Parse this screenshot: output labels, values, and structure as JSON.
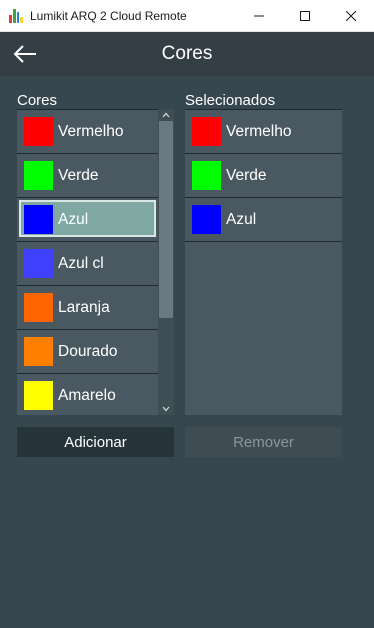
{
  "window": {
    "title": "Lumikit ARQ 2 Cloud Remote",
    "icons": [
      "app-logo-icon",
      "minimize-icon",
      "maximize-icon",
      "close-icon"
    ]
  },
  "appbar": {
    "title": "Cores",
    "back_icon": "arrow-left-icon"
  },
  "available": {
    "label": "Cores",
    "items": [
      {
        "name": "Vermelho",
        "color": "#ff0000"
      },
      {
        "name": "Verde",
        "color": "#00ff00"
      },
      {
        "name": "Azul",
        "color": "#0000ff",
        "selected": true
      },
      {
        "name": "Azul cl",
        "color": "#4040ff"
      },
      {
        "name": "Laranja",
        "color": "#ff6600"
      },
      {
        "name": "Dourado",
        "color": "#ff8000"
      },
      {
        "name": "Amarelo",
        "color": "#ffff00"
      }
    ],
    "scrollbar": {
      "up_icon": "chevron-up-icon",
      "down_icon": "chevron-down-icon"
    }
  },
  "selected": {
    "label": "Selecionados",
    "items": [
      {
        "name": "Vermelho",
        "color": "#ff0000"
      },
      {
        "name": "Verde",
        "color": "#00ff00"
      },
      {
        "name": "Azul",
        "color": "#0000ff"
      }
    ]
  },
  "actions": {
    "add_label": "Adicionar",
    "remove_label": "Remover",
    "remove_enabled": false
  },
  "theme": {
    "background": "#37474f",
    "panel": "#4a5961",
    "selection": "#7fa8a3"
  }
}
